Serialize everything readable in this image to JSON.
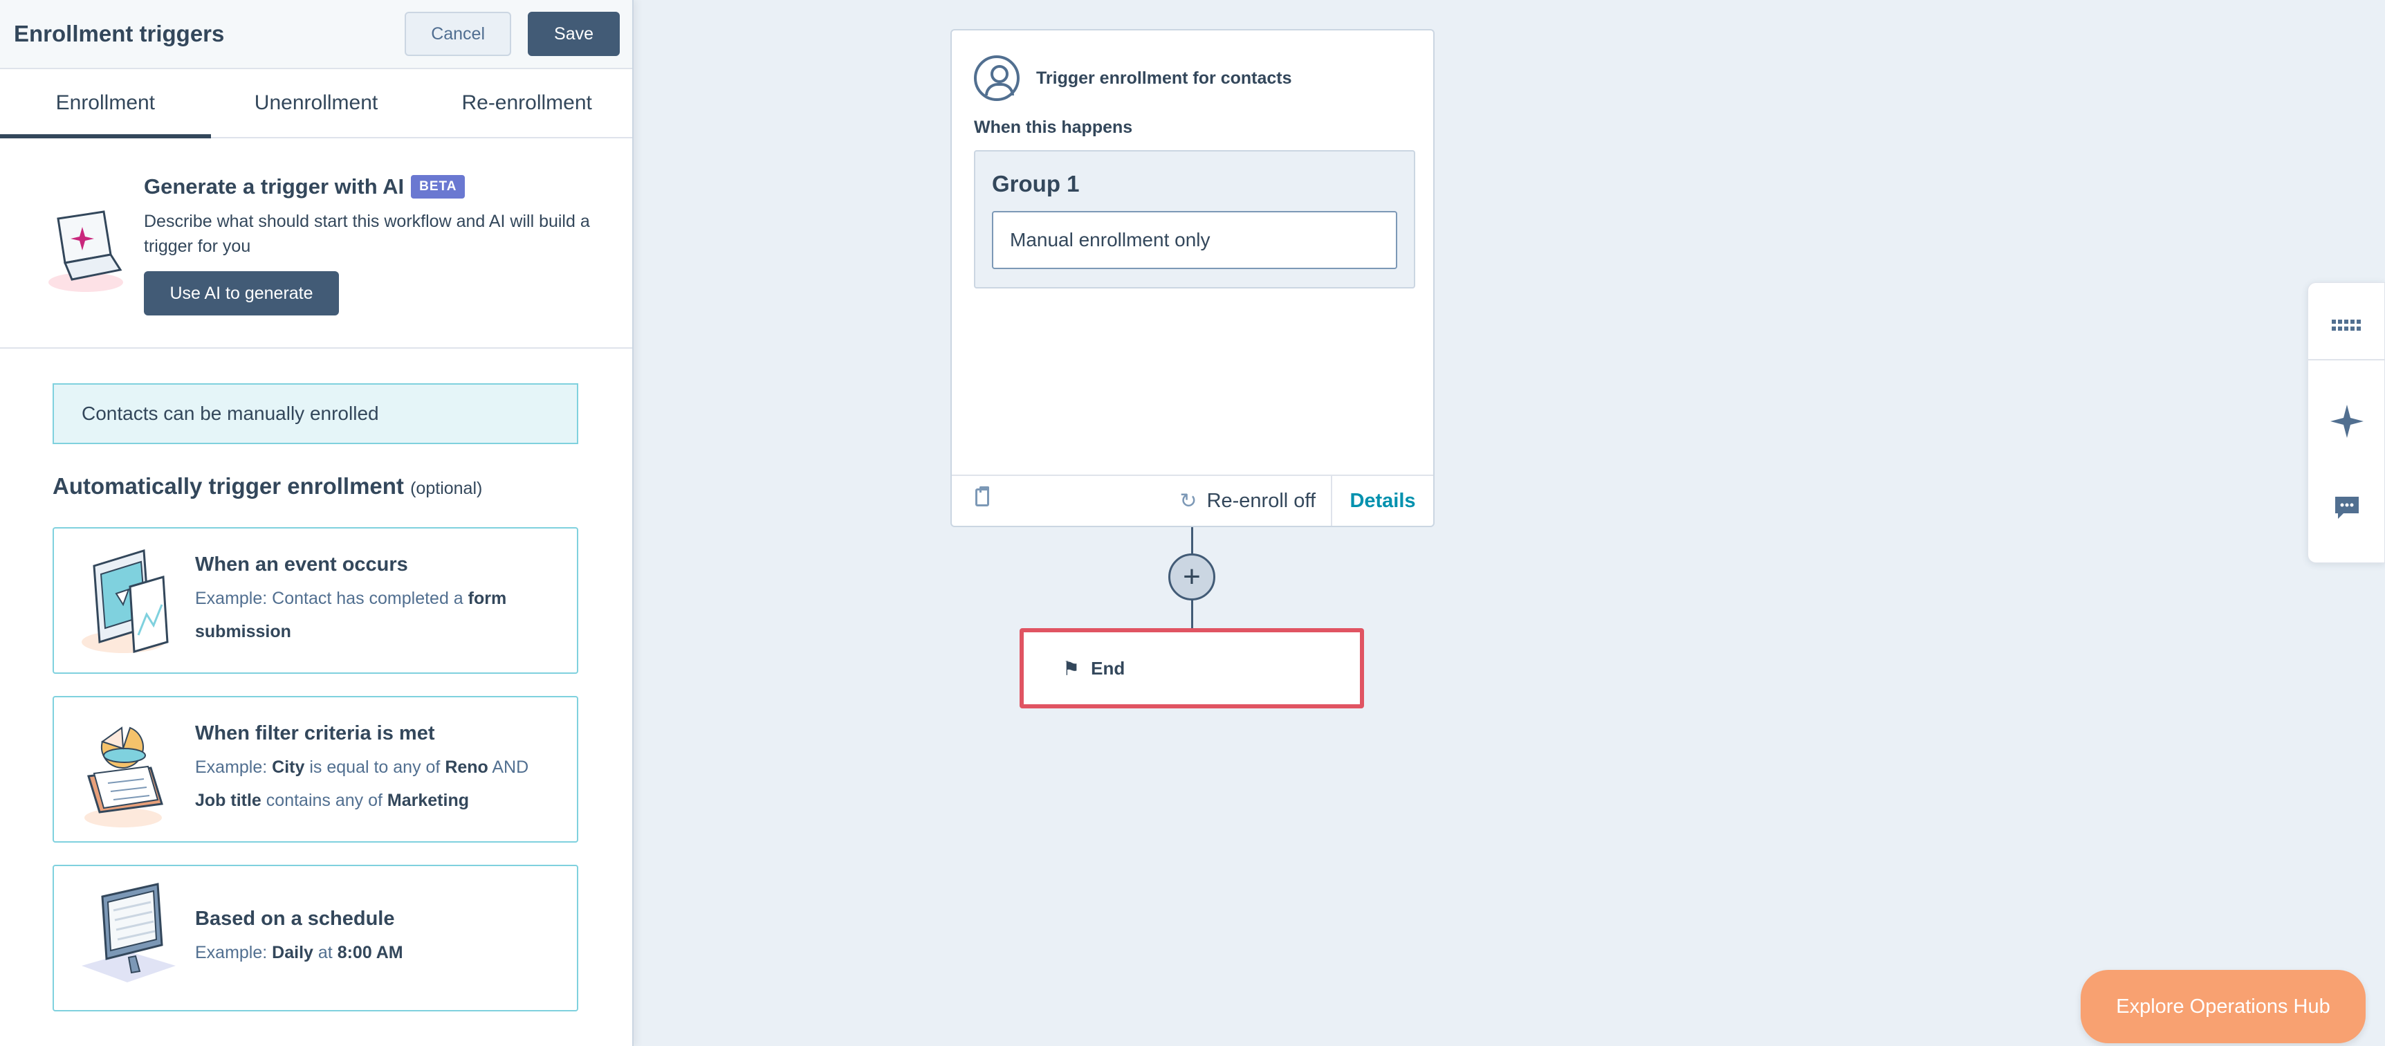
{
  "panel": {
    "title": "Enrollment triggers",
    "cancel_label": "Cancel",
    "save_label": "Save",
    "tabs": [
      {
        "label": "Enrollment",
        "active": true
      },
      {
        "label": "Unenrollment",
        "active": false
      },
      {
        "label": "Re-enrollment",
        "active": false
      }
    ],
    "ai": {
      "title": "Generate a trigger with AI",
      "badge": "BETA",
      "description": "Describe what should start this workflow and AI will build a trigger for you",
      "button_label": "Use AI to generate"
    },
    "manual_note": "Contacts can be manually enrolled",
    "auto_title": "Automatically trigger enrollment",
    "auto_optional": "(optional)",
    "cards": [
      {
        "title": "When an event occurs",
        "example_prefix": "Example: Contact has completed a ",
        "example_bold": "form submission"
      },
      {
        "title": "When filter criteria is met",
        "ex_1": "Example: ",
        "ex_city": "City",
        "ex_2": " is equal to any of ",
        "ex_reno": "Reno",
        "ex_3": " AND ",
        "ex_job": "Job title",
        "ex_4": " contains any of ",
        "ex_mkt": "Marketing"
      },
      {
        "title": "Based on a schedule",
        "ex_1": "Example: ",
        "ex_daily": "Daily",
        "ex_2": " at ",
        "ex_time": "8:00 AM"
      }
    ]
  },
  "canvas": {
    "trigger_card": {
      "title": "Trigger enrollment for contacts",
      "when_label": "When this happens",
      "group_title": "Group 1",
      "group_value": "Manual enrollment only",
      "reenroll_label": "Re-enroll off",
      "details_label": "Details"
    },
    "add_symbol": "+",
    "end_label": "End"
  },
  "side_tools": [
    "grid-icon",
    "sparkle-icon",
    "chat-icon"
  ],
  "explore_label": "Explore Operations Hub",
  "colors": {
    "primary_dark": "#425b76",
    "accent_teal": "#7fd1de",
    "link_teal": "#0091ae",
    "beta_purple": "#6a78d1",
    "highlight_red": "#e05462",
    "explore_orange": "#f8a171"
  }
}
